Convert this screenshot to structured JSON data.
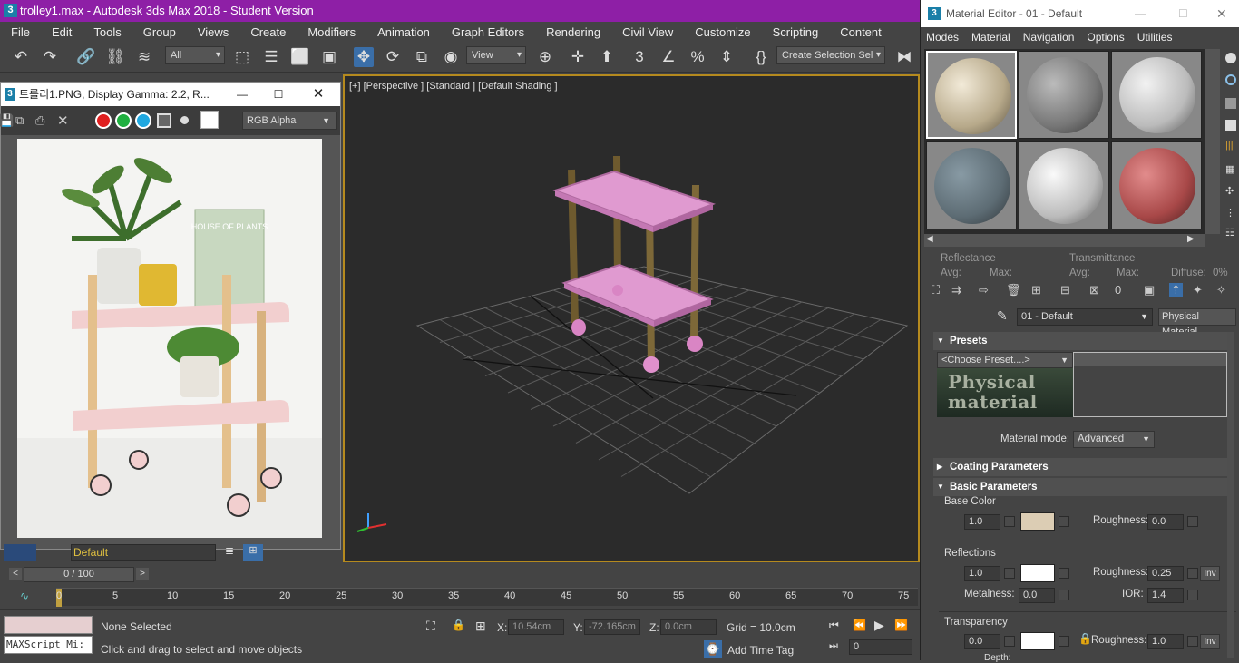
{
  "main": {
    "title": "trolley1.max - Autodesk 3ds Max 2018 - Student Version",
    "logo": "3",
    "menu": [
      "File",
      "Edit",
      "Tools",
      "Group",
      "Views",
      "Create",
      "Modifiers",
      "Animation",
      "Graph Editors",
      "Rendering",
      "Civil View",
      "Customize",
      "Scripting",
      "Content"
    ],
    "toolbar": {
      "filter_value": "All",
      "ref_coord_value": "View",
      "selection_set_value": "Create Selection Sel"
    }
  },
  "viewport": {
    "label": "[+] [Perspective ] [Standard ] [Default Shading ]"
  },
  "image_window": {
    "title": "트롤리1.PNG, Display Gamma: 2.2, R...",
    "channel_value": "RGB Alpha",
    "book_text": "HOUSE OF PLANTS",
    "colors": {
      "red": "#e02020",
      "green": "#20b040",
      "blue": "#20a8e0"
    }
  },
  "material_editor": {
    "title": "Material Editor - 01 - Default",
    "logo": "3",
    "menu": [
      "Modes",
      "Material",
      "Navigation",
      "Options",
      "Utilities"
    ],
    "reflectance_label": "Reflectance",
    "transmittance_label": "Transmittance",
    "avg_label": "Avg:",
    "max_label": "Max:",
    "diffuse_label": "Diffuse:",
    "diffuse_value": "0%",
    "material_name": "01 - Default",
    "material_type": "Physical Material",
    "presets_title": "Presets",
    "preset_value": "<Choose Preset....>",
    "physical_logo": "Physical material",
    "material_mode_label": "Material mode:",
    "material_mode_value": "Advanced",
    "coating_title": "Coating Parameters",
    "basic_title": "Basic Parameters",
    "base_color_label": "Base Color",
    "base_weight": "1.0",
    "base_roughness_label": "Roughness:",
    "base_roughness": "0.0",
    "reflections_label": "Reflections",
    "refl_weight": "1.0",
    "refl_roughness_label": "Roughness:",
    "refl_roughness": "0.25",
    "inv_label": "Inv",
    "metalness_label": "Metalness:",
    "metalness": "0.0",
    "ior_label": "IOR:",
    "ior": "1.4",
    "transparency_label": "Transparency",
    "trans_weight": "0.0",
    "trans_roughness_label": "Roughness:",
    "trans_roughness": "1.0",
    "depth_label": "Depth:"
  },
  "timeline": {
    "layer_value": "Default",
    "frame_counter": "0 / 100",
    "ticks": [
      "0",
      "5",
      "10",
      "15",
      "20",
      "25",
      "30",
      "35",
      "40",
      "45",
      "50",
      "55",
      "60",
      "65",
      "70",
      "75"
    ]
  },
  "status": {
    "maxscript": "MAXScript Mi:",
    "selection": "None Selected",
    "prompt": "Click and drag to select and move objects",
    "x_label": "X:",
    "x_value": "10.54cm",
    "y_label": "Y:",
    "y_value": "-72.165cm",
    "z_label": "Z:",
    "z_value": "0.0cm",
    "grid": "Grid = 10.0cm",
    "add_time_tag": "Add Time Tag",
    "frame_value": "0"
  }
}
